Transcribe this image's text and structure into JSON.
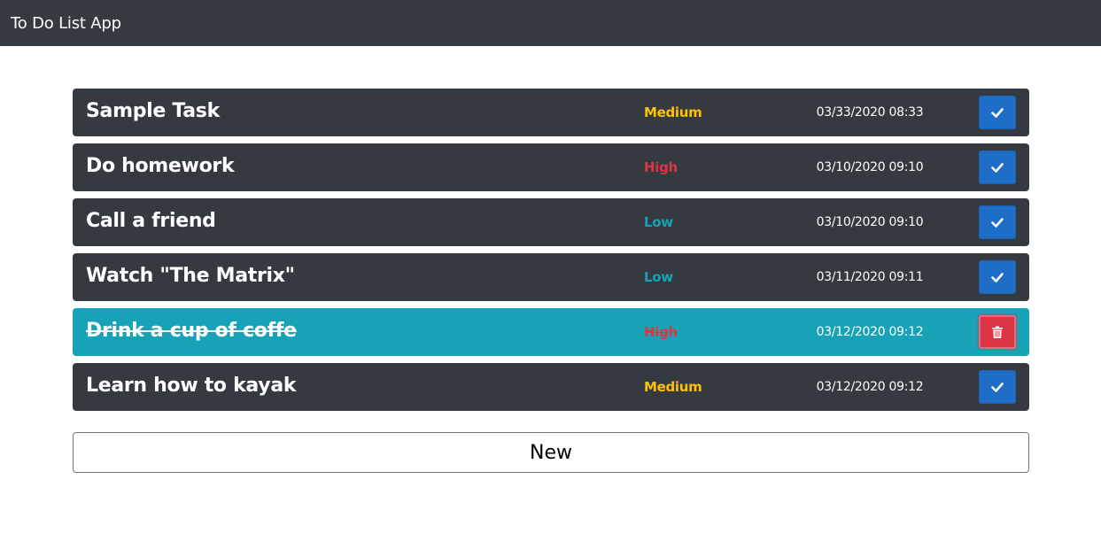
{
  "navbar": {
    "brand": "To Do List App"
  },
  "colors": {
    "priority_high": "#dc3545",
    "priority_medium": "#ffc107",
    "priority_low": "#17a2b8",
    "row_default": "#343a40",
    "row_done": "#17a2b8",
    "check_button": "#1e6ec8",
    "delete_button": "#dc3545"
  },
  "tasks": [
    {
      "title": "Sample Task",
      "priority": "Medium",
      "date": "03/33/2020 08:33",
      "done": false,
      "action_icon": "check-icon"
    },
    {
      "title": "Do homework",
      "priority": "High",
      "date": "03/10/2020 09:10",
      "done": false,
      "action_icon": "check-icon"
    },
    {
      "title": "Call a friend",
      "priority": "Low",
      "date": "03/10/2020 09:10",
      "done": false,
      "action_icon": "check-icon"
    },
    {
      "title": "Watch \"The Matrix\"",
      "priority": "Low",
      "date": "03/11/2020 09:11",
      "done": false,
      "action_icon": "check-icon"
    },
    {
      "title": "Drink a cup of coffe",
      "priority": "High",
      "date": "03/12/2020 09:12",
      "done": true,
      "action_icon": "trash-icon"
    },
    {
      "title": "Learn how to kayak",
      "priority": "Medium",
      "date": "03/12/2020 09:12",
      "done": false,
      "action_icon": "check-icon"
    }
  ],
  "new_button": {
    "label": "New"
  }
}
